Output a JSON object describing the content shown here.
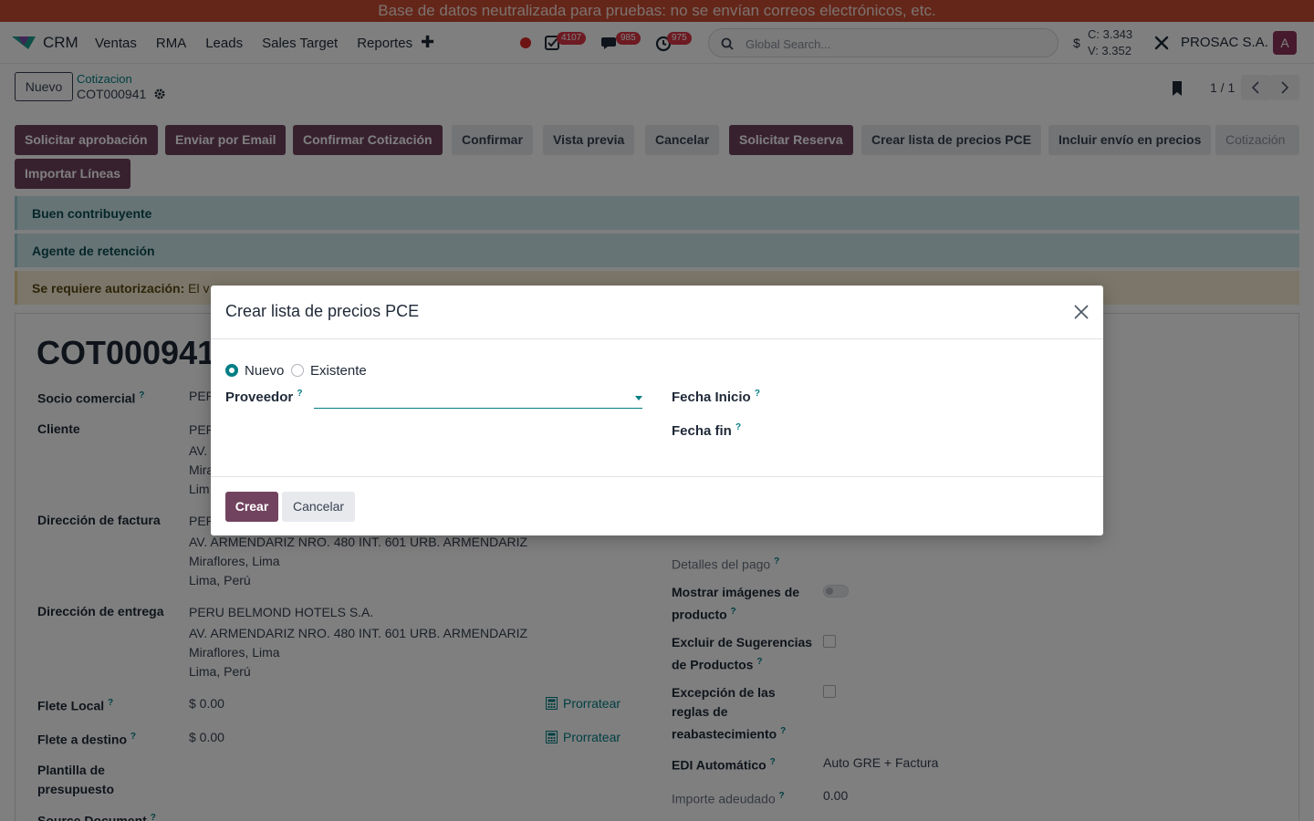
{
  "banner": "Base de datos neutralizada para pruebas: no se envían correos electrónicos, etc.",
  "navbar": {
    "app_name": "CRM",
    "menu": [
      "Ventas",
      "RMA",
      "Leads",
      "Sales Target",
      "Reportes"
    ],
    "plus": "✚",
    "activity_count": "4107",
    "messages_count": "985",
    "timer_count": "975",
    "search_placeholder": "Global Search...",
    "currency": "$",
    "rate_c": "C: 3.343",
    "rate_v": "V: 3.352",
    "company": "PROSAC S.A.",
    "avatar": "A"
  },
  "control": {
    "new_button": "Nuevo",
    "breadcrumb_parent": "Cotizacion",
    "breadcrumb_current": "COT000941",
    "pager": "1 / 1"
  },
  "buttons": {
    "solicitar_aprobacion": "Solicitar aprobación",
    "enviar_email": "Enviar por Email",
    "confirmar_cotizacion": "Confirmar Cotización",
    "confirmar": "Confirmar",
    "vista_previa": "Vista previa",
    "cancelar": "Cancelar",
    "solicitar_reserva": "Solicitar Reserva",
    "crear_lista": "Crear lista de precios PCE",
    "incluir_envio": "Incluir envío en precios",
    "status": "Cotización",
    "importar_lineas": "Importar Líneas"
  },
  "alerts": {
    "buen_contribuyente": "Buen contribuyente",
    "agente_retencion": "Agente de retención",
    "autorizacion_label": "Se requiere autorización:",
    "autorizacion_text": "El v"
  },
  "form": {
    "title": "COT000941",
    "socio_label": "Socio comercial",
    "socio_value": "PER",
    "cliente_label": "Cliente",
    "cliente_lines": [
      "PER",
      "AV.",
      "Mira",
      "Lim"
    ],
    "factura_label": "Dirección de factura",
    "factura_lines": [
      "PER",
      "AV. ARMENDARIZ NRO. 480 INT. 601 URB. ARMENDARIZ",
      "Miraflores, Lima",
      "Lima, Perú"
    ],
    "entrega_label": "Dirección de entrega",
    "entrega_lines": [
      "PERU BELMOND HOTELS S.A.",
      "AV. ARMENDARIZ NRO. 480 INT. 601 URB. ARMENDARIZ",
      "Miraflores, Lima",
      "Lima, Perú"
    ],
    "flete_local_label": "Flete Local",
    "flete_local_value": "$ 0.00",
    "flete_destino_label": "Flete a destino",
    "flete_destino_value": "$ 0.00",
    "prorratear": "Prorratear",
    "plantilla_label_1": "Plantilla de",
    "plantilla_label_2": "presupuesto",
    "source_label": "Source Document",
    "detalles_pago_label": "Detalles del pago",
    "mostrar_imagenes_1": "Mostrar imágenes de",
    "mostrar_imagenes_2": "producto",
    "excluir_1": "Excluir de Sugerencias",
    "excluir_2": "de Productos",
    "excepcion_1": "Excepción de las",
    "excepcion_2": "reglas de",
    "excepcion_3": "reabastecimiento",
    "edi_label": "EDI Automático",
    "edi_value": "Auto GRE + Factura",
    "importe_label": "Importe adeudado",
    "importe_value": "0.00"
  },
  "modal": {
    "title": "Crear lista de precios PCE",
    "radio_nuevo": "Nuevo",
    "radio_existente": "Existente",
    "proveedor_label": "Proveedor",
    "fecha_inicio_label": "Fecha Inicio",
    "fecha_fin_label": "Fecha fin",
    "crear_button": "Crear",
    "cancelar_button": "Cancelar",
    "help_mark": "?"
  },
  "colors": {
    "banner": "#c94c32",
    "primary": "#71435f",
    "accent": "#017e84"
  }
}
